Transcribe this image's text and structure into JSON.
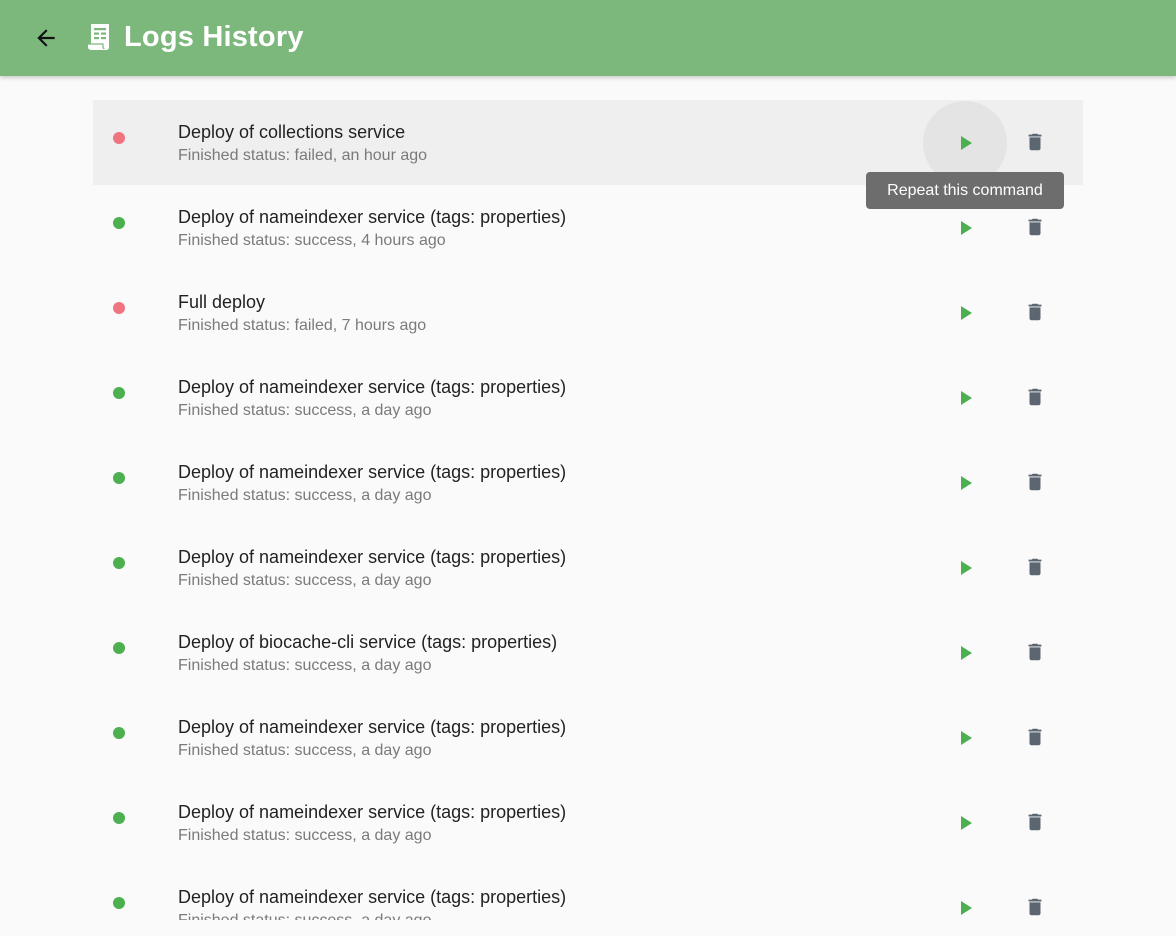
{
  "header": {
    "title": "Logs History",
    "back_icon": "arrow-left-icon",
    "title_icon": "receipt-icon",
    "background": "#7cb87c"
  },
  "colors": {
    "success": "#4caf50",
    "failed": "#f07480",
    "play": "#4caf50",
    "trash": "#5b6670"
  },
  "tooltip": {
    "text": "Repeat this command"
  },
  "logs": [
    {
      "title": "Deploy of collections service",
      "subtitle": "Finished status: failed, an hour ago",
      "status": "failed"
    },
    {
      "title": "Deploy of nameindexer service (tags: properties)",
      "subtitle": "Finished status: success, 4 hours ago",
      "status": "success"
    },
    {
      "title": "Full deploy",
      "subtitle": "Finished status: failed, 7 hours ago",
      "status": "failed"
    },
    {
      "title": "Deploy of nameindexer service (tags: properties)",
      "subtitle": "Finished status: success, a day ago",
      "status": "success"
    },
    {
      "title": "Deploy of nameindexer service (tags: properties)",
      "subtitle": "Finished status: success, a day ago",
      "status": "success"
    },
    {
      "title": "Deploy of nameindexer service (tags: properties)",
      "subtitle": "Finished status: success, a day ago",
      "status": "success"
    },
    {
      "title": "Deploy of biocache-cli service (tags: properties)",
      "subtitle": "Finished status: success, a day ago",
      "status": "success"
    },
    {
      "title": "Deploy of nameindexer service (tags: properties)",
      "subtitle": "Finished status: success, a day ago",
      "status": "success"
    },
    {
      "title": "Deploy of nameindexer service (tags: properties)",
      "subtitle": "Finished status: success, a day ago",
      "status": "success"
    },
    {
      "title": "Deploy of nameindexer service (tags: properties)",
      "subtitle": "Finished status: success, a day ago",
      "status": "success"
    }
  ]
}
